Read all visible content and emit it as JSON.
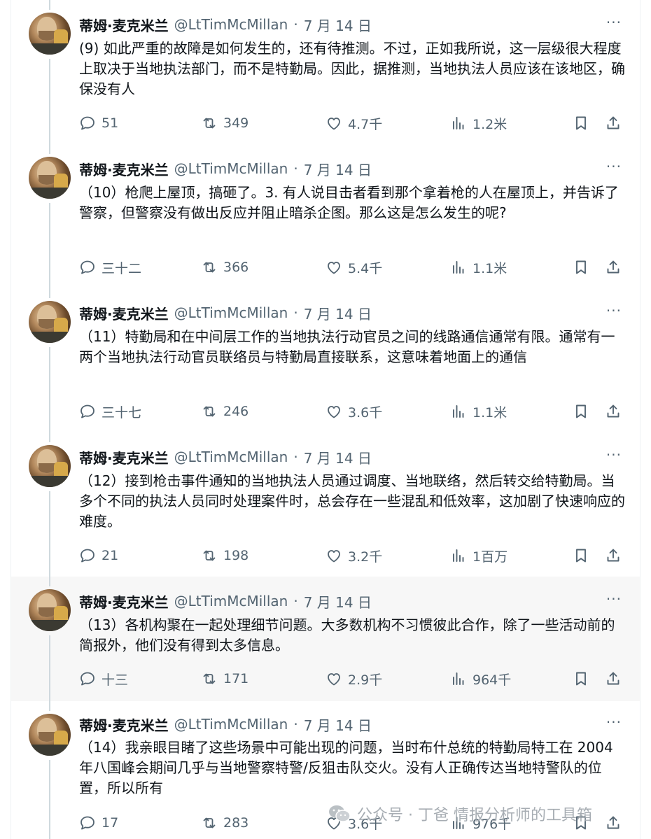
{
  "tweets": [
    {
      "author": "蒂姆·麦克米兰",
      "handle": "@LtTimMcMillan",
      "date": "7 月 14 日",
      "more_label": "···",
      "text": "(9) 如此严重的故障是如何发生的，还有待推测。不过，正如我所说，这一层级很大程度上取决于当地执法部门，而不是特勤局。因此，据推测，当地执法人员应该在该地区，确保没有人",
      "stats": {
        "replies": "51",
        "reposts": "349",
        "likes": "4.7千",
        "views": "1.2米"
      }
    },
    {
      "author": "蒂姆·麦克米兰",
      "handle": "@LtTimMcMillan",
      "date": "7 月 14 日",
      "more_label": "···",
      "text": "（10）枪爬上屋顶，搞砸了。3. 有人说目击者看到那个拿着枪的人在屋顶上，并告诉了警察，但警察没有做出反应并阻止暗杀企图。那么这是怎么发生的呢?",
      "stats": {
        "replies": "三十二",
        "reposts": "366",
        "likes": "5.4千",
        "views": "1.1米"
      }
    },
    {
      "author": "蒂姆·麦克米兰",
      "handle": "@LtTimMcMillan",
      "date": "7 月 14 日",
      "more_label": "···",
      "text": "（11）特勤局和在中间层工作的当地执法行动官员之间的线路通信通常有限。通常有一两个当地执法行动官员联络员与特勤局直接联系，这意味着地面上的通信",
      "stats": {
        "replies": "三十七",
        "reposts": "246",
        "likes": "3.6千",
        "views": "1.1米"
      }
    },
    {
      "author": "蒂姆·麦克米兰",
      "handle": "@LtTimMcMillan",
      "date": "7 月 14 日",
      "more_label": "···",
      "text": "（12）接到枪击事件通知的当地执法人员通过调度、当地联络，然后转交给特勤局。当多个不同的执法人员同时处理案件时，总会存在一些混乱和低效率，这加剧了快速响应的难度。",
      "stats": {
        "replies": "21",
        "reposts": "198",
        "likes": "3.2千",
        "views": "1百万"
      }
    },
    {
      "author": "蒂姆·麦克米兰",
      "handle": "@LtTimMcMillan",
      "date": "7 月 14 日",
      "more_label": "···",
      "text": "（13）各机构聚在一起处理细节问题。大多数机构不习惯彼此合作，除了一些活动前的简报外，他们没有得到太多信息。",
      "stats": {
        "replies": "十三",
        "reposts": "171",
        "likes": "2.9千",
        "views": "964千"
      }
    },
    {
      "author": "蒂姆·麦克米兰",
      "handle": "@LtTimMcMillan",
      "date": "7 月 14 日",
      "more_label": "···",
      "text": "（14）我亲眼目睹了这些场景中可能出现的问题，当时布什总统的特勤局特工在 2004 年八国峰会期间几乎与当地警察特警/反狙击队交火。没有人正确传达当地特警队的位置，所以所有",
      "stats": {
        "replies": "17",
        "reposts": "283",
        "likes": "3.6千",
        "views": "976千"
      }
    }
  ],
  "watermark": {
    "text": "公众号 · 丁爸 情报分析师的工具箱"
  },
  "icons": [
    "reply-icon",
    "repost-icon",
    "like-icon",
    "views-icon",
    "bookmark-icon",
    "share-icon",
    "more-icon",
    "wechat-icon"
  ],
  "colors": {
    "text": "#0f1419",
    "secondary": "#536471",
    "thread_line": "#cfd9de",
    "highlight_bg": "#f7f7f7"
  }
}
